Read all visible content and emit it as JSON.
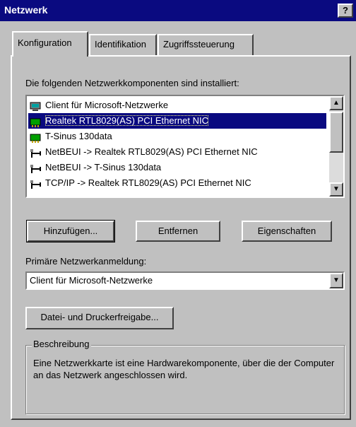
{
  "window": {
    "title": "Netzwerk",
    "help_label": "?"
  },
  "tabs": [
    {
      "label": "Konfiguration",
      "active": true
    },
    {
      "label": "Identifikation",
      "active": false
    },
    {
      "label": "Zugriffssteuerung",
      "active": false
    }
  ],
  "components_label": "Die folgenden Netzwerkkomponenten sind installiert:",
  "components": [
    {
      "label": "Client für Microsoft-Netzwerke",
      "icon": "network-client-icon",
      "selected": false
    },
    {
      "label": "Realtek RTL8029(AS) PCI Ethernet NIC",
      "icon": "network-adapter-icon",
      "selected": true
    },
    {
      "label": "T-Sinus 130data",
      "icon": "network-adapter-icon",
      "selected": false
    },
    {
      "label": "NetBEUI -> Realtek RTL8029(AS) PCI Ethernet NIC",
      "icon": "protocol-icon",
      "selected": false
    },
    {
      "label": "NetBEUI -> T-Sinus 130data",
      "icon": "protocol-icon",
      "selected": false
    },
    {
      "label": "TCP/IP -> Realtek RTL8029(AS) PCI Ethernet NIC",
      "icon": "protocol-icon",
      "selected": false
    }
  ],
  "buttons": {
    "add": "Hinzufügen...",
    "remove": "Entfernen",
    "properties": "Eigenschaften",
    "file_print": "Datei- und Druckerfreigabe..."
  },
  "primary_logon": {
    "label": "Primäre Netzwerkanmeldung:",
    "value": "Client für Microsoft-Netzwerke"
  },
  "description": {
    "title": "Beschreibung",
    "text": "Eine Netzwerkkarte ist eine Hardwarekomponente, über die der Computer an das Netzwerk angeschlossen wird."
  },
  "colors": {
    "titlebar": "#0a0a80",
    "face": "#c0c0c0",
    "selection": "#0a0a80"
  }
}
